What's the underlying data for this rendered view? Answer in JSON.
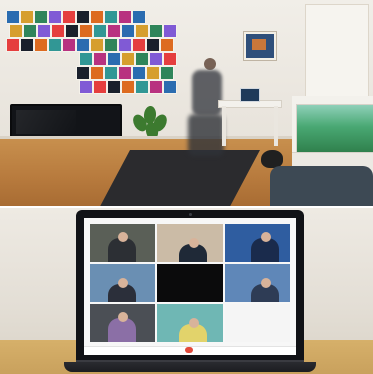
{
  "photos": {
    "top": {
      "scene": "home-workout-living-room"
    },
    "bottom": {
      "scene": "laptop-video-call-grid"
    }
  },
  "colors": {
    "wall": "#ece8e1",
    "floor": "#b77a3d",
    "aquarium_water": "#49a873",
    "laptop": "#111216",
    "end_call": "#e24a3b"
  },
  "video_call": {
    "layout": "3x3",
    "tiles": [
      {
        "bg": "#5a5f57",
        "fig": "#2c2f34"
      },
      {
        "bg": "#cbbba6",
        "fig": "#1f2937"
      },
      {
        "bg": "#2f5da0",
        "fig": "#1a2b4c"
      },
      {
        "bg": "#6a8fb3",
        "fig": "#2b2f3a"
      },
      {
        "bg": "#0b0b0c",
        "fig": "#0b0b0c"
      },
      {
        "bg": "#5f87b8",
        "fig": "#2e3c55"
      },
      {
        "bg": "#4b4f55",
        "fig": "#8b6fa6"
      },
      {
        "bg": "#6fb7b4",
        "fig": "#e2d36b"
      },
      {
        "bg": "#f5f5f5",
        "fig": "#ffffff"
      }
    ]
  }
}
